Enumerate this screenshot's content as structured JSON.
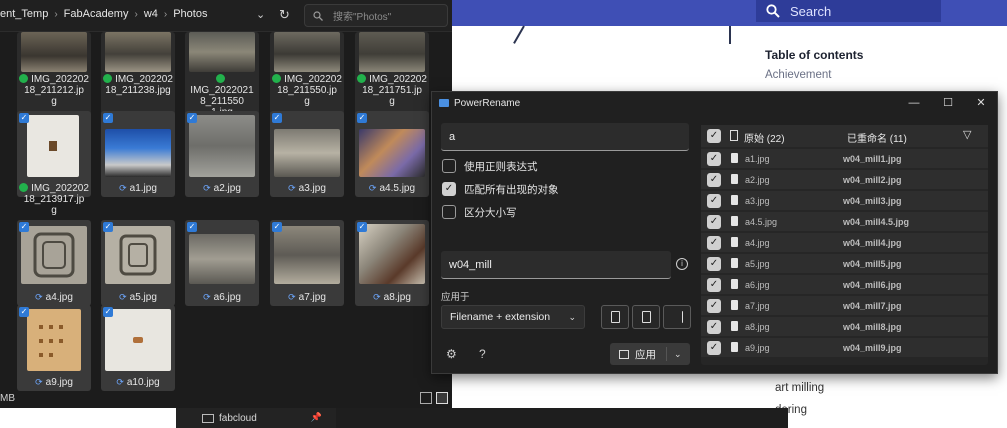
{
  "web": {
    "search_label": "Search",
    "toc_title": "Table of contents",
    "toc_item": "Achievement",
    "bottom_1": "art milling",
    "bottom_2": "dering",
    "colors": {
      "topbar": "#3f4fb5"
    }
  },
  "explorer": {
    "breadcrumb": [
      "ent_Temp",
      "FabAcademy",
      "w4",
      "Photos"
    ],
    "search_placeholder": "搜索\"Photos\"",
    "status_size": "MB",
    "files": [
      {
        "name": "IMG_202202\n18_211212.jp\ng",
        "status": "ok",
        "selected": false
      },
      {
        "name": "IMG_202202\n18_211238.jpg",
        "status": "ok",
        "selected": false
      },
      {
        "name": "IMG_2022021\n8_211550\n1.jpg",
        "status": "ok",
        "selected": false
      },
      {
        "name": "IMG_202202\n18_211550.jp\ng",
        "status": "ok",
        "selected": false
      },
      {
        "name": "IMG_202202\n18_211751.jp\ng",
        "status": "ok",
        "selected": false
      },
      {
        "name": "IMG_202202\n18_213917.jp\ng",
        "status": "ok",
        "selected": true
      },
      {
        "name": "a1.jpg",
        "status": "sync",
        "selected": true
      },
      {
        "name": "a2.jpg",
        "status": "sync",
        "selected": true
      },
      {
        "name": "a3.jpg",
        "status": "sync",
        "selected": true
      },
      {
        "name": "a4.5.jpg",
        "status": "sync",
        "selected": true
      },
      {
        "name": "a4.jpg",
        "status": "sync",
        "selected": true
      },
      {
        "name": "a5.jpg",
        "status": "sync",
        "selected": true
      },
      {
        "name": "a6.jpg",
        "status": "sync",
        "selected": true
      },
      {
        "name": "a7.jpg",
        "status": "sync",
        "selected": true
      },
      {
        "name": "a8.jpg",
        "status": "sync",
        "selected": true
      },
      {
        "name": "a9.jpg",
        "status": "sync",
        "selected": true
      },
      {
        "name": "a10.jpg",
        "status": "sync",
        "selected": true
      }
    ]
  },
  "taskbar": {
    "item_label": "fabcloud"
  },
  "powerrename": {
    "title": "PowerRename",
    "search_value": "a",
    "options": [
      {
        "label": "使用正则表达式",
        "checked": false
      },
      {
        "label": "匹配所有出现的对象",
        "checked": true
      },
      {
        "label": "区分大小写",
        "checked": false
      }
    ],
    "replace_value": "w04_mill",
    "apply_to_label": "应用于",
    "apply_to_value": "Filename + extension",
    "apply_button": "应用",
    "list_header": {
      "original": "原始 (22)",
      "renamed": "已重命名 (11)"
    },
    "rows": [
      {
        "original": "a1.jpg",
        "renamed": "w04_mill1.jpg"
      },
      {
        "original": "a2.jpg",
        "renamed": "w04_mill2.jpg"
      },
      {
        "original": "a3.jpg",
        "renamed": "w04_mill3.jpg"
      },
      {
        "original": "a4.5.jpg",
        "renamed": "w04_mill4.5.jpg"
      },
      {
        "original": "a4.jpg",
        "renamed": "w04_mill4.jpg"
      },
      {
        "original": "a5.jpg",
        "renamed": "w04_mill5.jpg"
      },
      {
        "original": "a6.jpg",
        "renamed": "w04_mill6.jpg"
      },
      {
        "original": "a7.jpg",
        "renamed": "w04_mill7.jpg"
      },
      {
        "original": "a8.jpg",
        "renamed": "w04_mill8.jpg"
      },
      {
        "original": "a9.jpg",
        "renamed": "w04_mill9.jpg"
      }
    ]
  }
}
